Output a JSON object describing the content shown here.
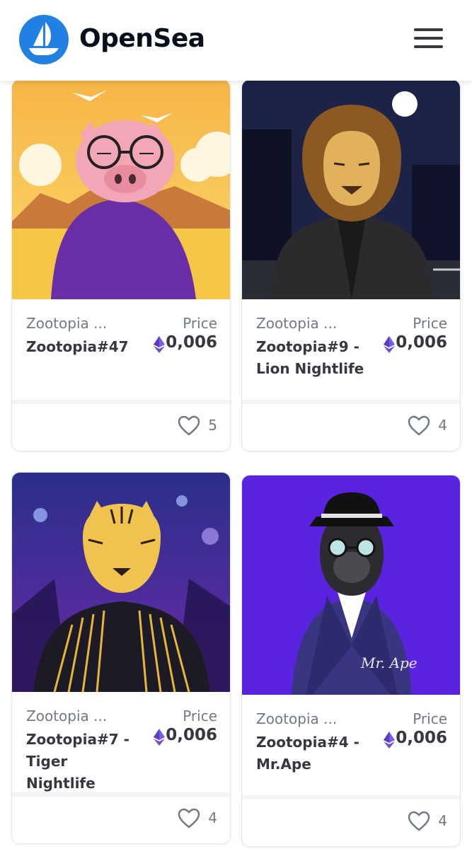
{
  "header": {
    "brand": "OpenSea",
    "logo_icon": "sailboat-logo-icon",
    "menu_icon": "hamburger-menu-icon"
  },
  "colors": {
    "brand_blue": "#2081e2",
    "eth_purple": "#6b4fd1",
    "text_dark": "#353840",
    "text_muted": "#707a83"
  },
  "cards": [
    {
      "collection": "Zootopia ...",
      "name": "Zootopia#47",
      "price_label": "Price",
      "price": "0,006",
      "likes": "5"
    },
    {
      "collection": "Zootopia ...",
      "name": "Zootopia#9 - Lion Nightlife",
      "price_label": "Price",
      "price": "0,006",
      "likes": "4"
    },
    {
      "collection": "Zootopia ...",
      "name": "Zootopia#7 - Tiger Nightlife",
      "price_label": "Price",
      "price": "0,006",
      "likes": "4"
    },
    {
      "collection": "Zootopia ...",
      "name": "Zootopia#4 - Mr.Ape",
      "price_label": "Price",
      "price": "0,006",
      "likes": "4",
      "image_signature": "Mr. Ape"
    }
  ]
}
